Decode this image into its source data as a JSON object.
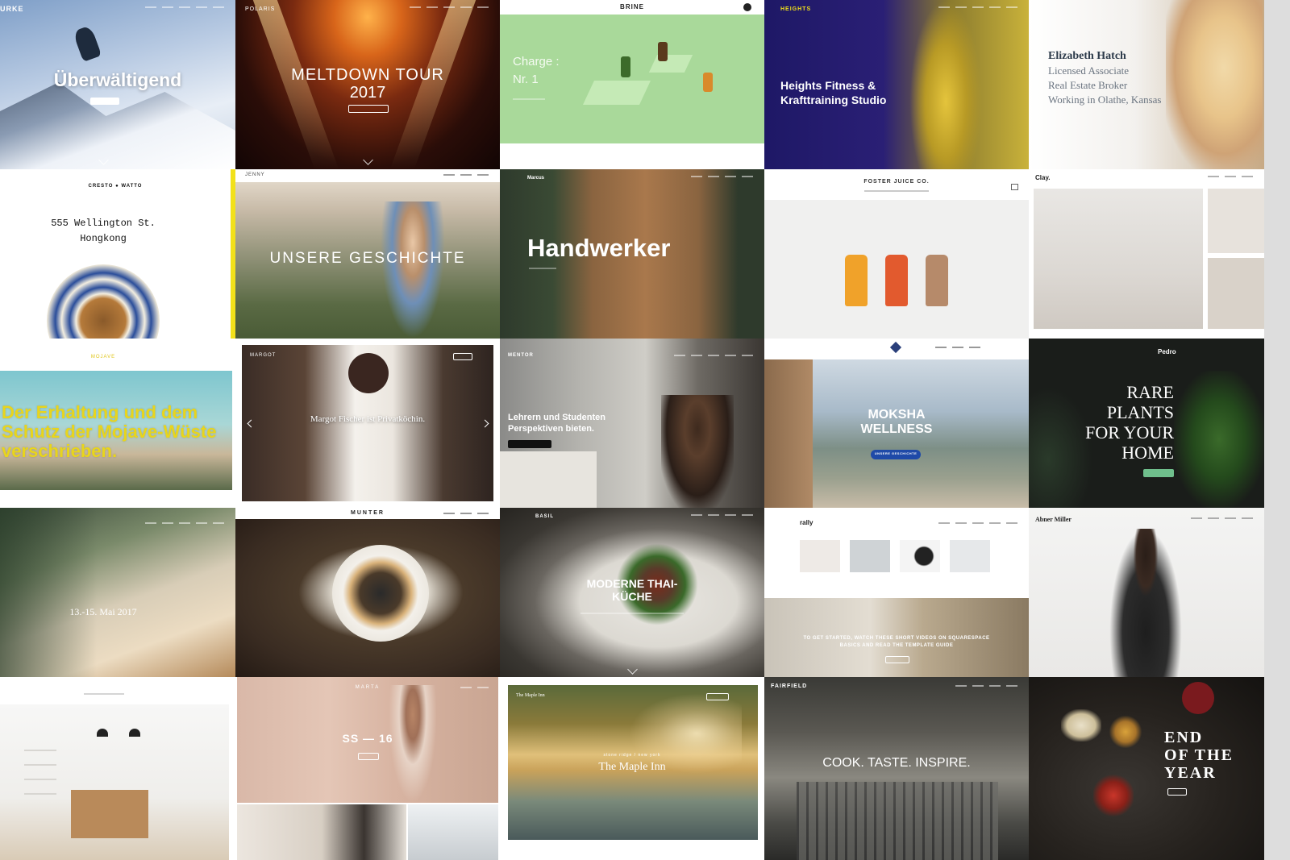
{
  "tiles": [
    {
      "id": "burke",
      "logo": "URKE",
      "headline": "Überwältigend"
    },
    {
      "id": "polaris",
      "logo": "POLARIS",
      "headline": "MELTDOWN TOUR",
      "headline2": "2017"
    },
    {
      "id": "brine",
      "logo": "BRINE",
      "headline": "Charge :",
      "headline2": "Nr. 1"
    },
    {
      "id": "heights",
      "logo": "HEIGHTS",
      "headline": "Heights Fitness &",
      "headline2": "Krafttraining Studio"
    },
    {
      "id": "hatch",
      "lines": [
        "Elizabeth Hatch",
        "Licensed Associate",
        "Real Estate Broker",
        "Working in Olathe, Kansas"
      ]
    },
    {
      "id": "cresto",
      "logo": "CRESTO ● WATTO",
      "headline": "555 Wellington St.",
      "headline2": "Hongkong"
    },
    {
      "id": "jenny",
      "logo": "JENNY",
      "headline": "UNSERE GESCHICHTE"
    },
    {
      "id": "handwerker",
      "logo": "Marcus",
      "headline": "Handwerker"
    },
    {
      "id": "foster",
      "logo": "FOSTER JUICE CO."
    },
    {
      "id": "clay",
      "logo": "Clay."
    },
    {
      "id": "mojave",
      "logo": "MOJAVE",
      "headline": "Der Erhaltung und dem Schutz der Mojave-Wüste verschrieben."
    },
    {
      "id": "margot",
      "logo": "MARGOT",
      "headline": "Margot Fischer ist Privatköchin."
    },
    {
      "id": "mentor",
      "logo": "MENTOR",
      "headline": "Lehrern und Studenten",
      "headline2": "Perspektiven bieten."
    },
    {
      "id": "moksha",
      "headline": "MOKSHA",
      "headline2": "WELLNESS",
      "button": "UNSERE GESCHICHTE"
    },
    {
      "id": "pedro",
      "logo": "Pedro",
      "lines": [
        "RARE",
        "PLANTS",
        "FOR YOUR",
        "HOME"
      ]
    },
    {
      "id": "festival",
      "headline": "13.-15. Mai 2017"
    },
    {
      "id": "munter",
      "logo": "MUNTER"
    },
    {
      "id": "basil",
      "logo": "BASIL",
      "headline": "MODERNE THAI-",
      "headline2": "KÜCHE"
    },
    {
      "id": "rally",
      "logo": "rally",
      "caption": "TO GET STARTED, WATCH THESE SHORT VIDEOS ON SQUARESPACE BASICS AND READ THE TEMPLATE GUIDE"
    },
    {
      "id": "miller",
      "logo": "Abner Miller"
    },
    {
      "id": "interior"
    },
    {
      "id": "marta",
      "logo": "MARTA",
      "headline": "SS — 16"
    },
    {
      "id": "maple",
      "logo": "The Maple Inn",
      "sub": "stone ridge / new york",
      "headline": "The Maple Inn"
    },
    {
      "id": "fairfield",
      "logo": "FAIRFIELD",
      "headline": "COOK. TASTE. INSPIRE."
    },
    {
      "id": "eoty",
      "lines": [
        "END",
        "OF THE",
        "YEAR"
      ]
    }
  ],
  "colors": {
    "accent_yellow": "#f2e11a",
    "moksha_button": "#1f4aa8",
    "pedro_button": "#6fbf8c",
    "heights_bg": "#2a1f75"
  }
}
